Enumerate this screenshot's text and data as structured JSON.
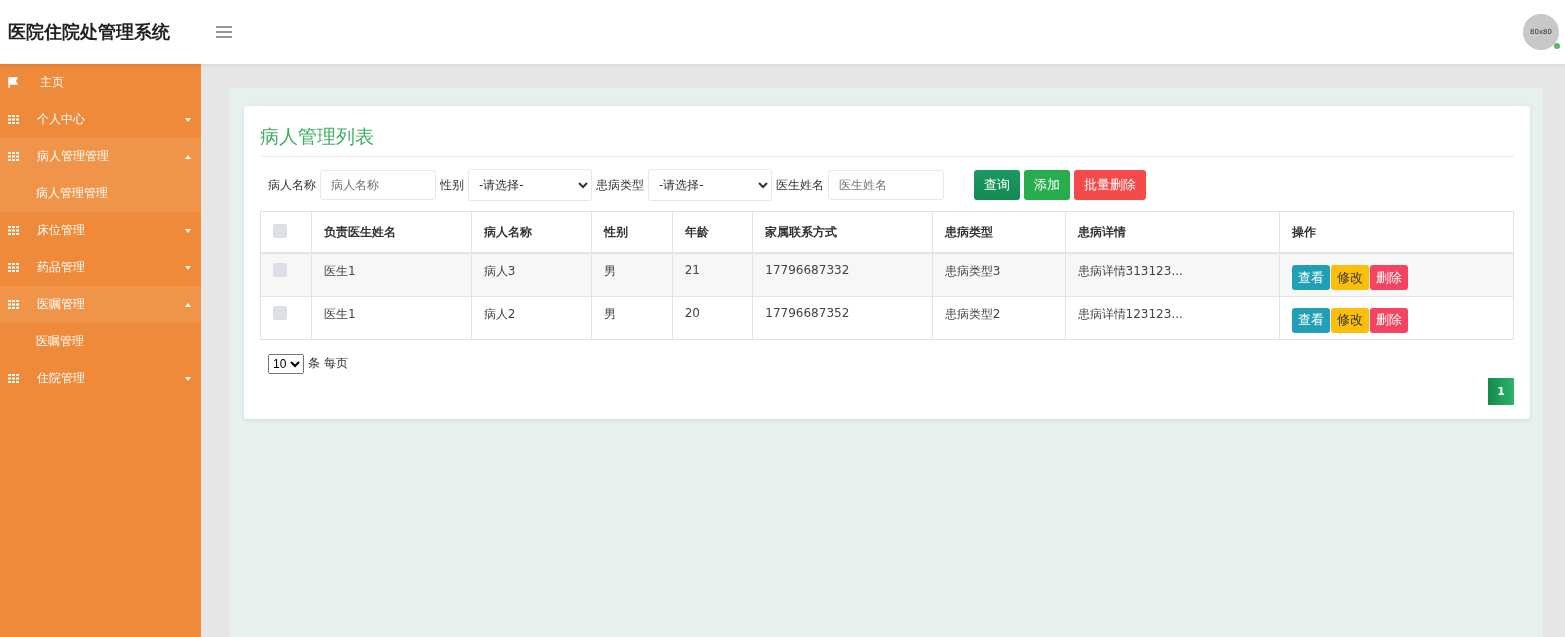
{
  "header": {
    "title": "医院住院处管理系统",
    "avatar": {
      "text": "80x80",
      "online": true
    }
  },
  "sidebar": {
    "items": [
      {
        "label": "主页",
        "kind": "link",
        "expanded": false
      },
      {
        "label": "个人中心",
        "kind": "group",
        "expanded": false
      },
      {
        "label": "病人管理管理",
        "kind": "group",
        "expanded": true,
        "children": [
          {
            "label": "病人管理管理"
          }
        ]
      },
      {
        "label": "床位管理",
        "kind": "group",
        "expanded": false
      },
      {
        "label": "药品管理",
        "kind": "group",
        "expanded": false
      },
      {
        "label": "医嘱管理",
        "kind": "group",
        "expanded": true,
        "children": [
          {
            "label": "医嘱管理"
          }
        ]
      },
      {
        "label": "住院管理",
        "kind": "group",
        "expanded": false
      }
    ]
  },
  "card": {
    "title": "病人管理列表",
    "filters": [
      {
        "kind": "input",
        "label": "病人名称",
        "placeholder": "病人名称"
      },
      {
        "kind": "select",
        "label": "性别",
        "value": "-请选择-"
      },
      {
        "kind": "select",
        "label": "患病类型",
        "value": "-请选择-"
      },
      {
        "kind": "input",
        "label": "医生姓名",
        "placeholder": "医生姓名"
      }
    ],
    "buttons": [
      {
        "label": "查询",
        "kind": "search"
      },
      {
        "label": "添加",
        "kind": "add"
      },
      {
        "label": "批量删除",
        "kind": "delete"
      }
    ],
    "table": {
      "header_checked": false,
      "columns": [
        "负责医生姓名",
        "病人名称",
        "性别",
        "年龄",
        "家属联系方式",
        "患病类型",
        "患病详情",
        "操作"
      ],
      "rows": [
        {
          "checked": false,
          "cells": [
            "医生1",
            "病人3",
            "男",
            "21",
            "17796687332",
            "患病类型3",
            "患病详情313123..."
          ],
          "actions": [
            {
              "label": "查看",
              "kind": "view"
            },
            {
              "label": "修改",
              "kind": "edit"
            },
            {
              "label": "删除",
              "kind": "delete"
            }
          ]
        },
        {
          "checked": false,
          "cells": [
            "医生1",
            "病人2",
            "男",
            "20",
            "17796687352",
            "患病类型2",
            "患病详情123123..."
          ],
          "actions": [
            {
              "label": "查看",
              "kind": "view"
            },
            {
              "label": "修改",
              "kind": "edit"
            },
            {
              "label": "删除",
              "kind": "delete"
            }
          ]
        }
      ]
    },
    "page_size": {
      "value": "10",
      "label": "条 每页"
    },
    "pagination": [
      {
        "label": "1",
        "selected": true
      }
    ]
  }
}
